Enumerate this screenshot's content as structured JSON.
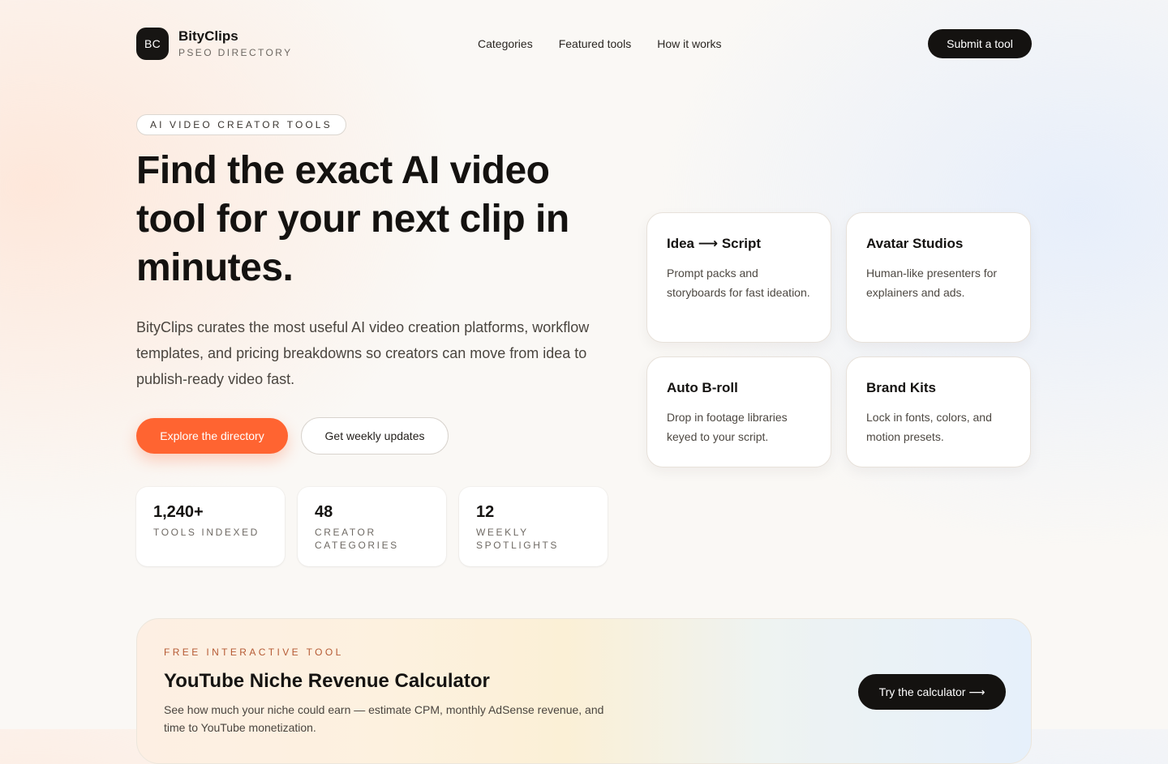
{
  "brand": {
    "mark": "BC",
    "name": "BityClips",
    "tagline": "PSEO DIRECTORY"
  },
  "nav": {
    "items": [
      {
        "label": "Categories"
      },
      {
        "label": "Featured tools"
      },
      {
        "label": "How it works"
      }
    ],
    "cta_label": "Submit a tool"
  },
  "hero": {
    "eyebrow": "AI VIDEO CREATOR TOOLS",
    "headline": "Find the exact AI video tool for your next clip in minutes.",
    "description": "BityClips curates the most useful AI video creation platforms, workflow templates, and pricing breakdowns so creators can move from idea to publish-ready video fast.",
    "primary_cta": "Explore the directory",
    "secondary_cta": "Get weekly updates"
  },
  "stats": [
    {
      "value": "1,240+",
      "label": "TOOLS INDEXED"
    },
    {
      "value": "48",
      "label": "CREATOR CATEGORIES"
    },
    {
      "value": "12",
      "label": "WEEKLY SPOTLIGHTS"
    }
  ],
  "features": [
    {
      "title": "Idea ⟶ Script",
      "description": "Prompt packs and storyboards for fast ideation."
    },
    {
      "title": "Avatar Studios",
      "description": "Human-like presenters for explainers and ads."
    },
    {
      "title": "Auto B-roll",
      "description": "Drop in footage libraries keyed to your script."
    },
    {
      "title": "Brand Kits",
      "description": "Lock in fonts, colors, and motion presets."
    }
  ],
  "calculator": {
    "kicker": "FREE INTERACTIVE TOOL",
    "title": "YouTube Niche Revenue Calculator",
    "description": "See how much your niche could earn — estimate CPM, monthly AdSense revenue, and time to YouTube monetization.",
    "cta": "Try the calculator ⟶"
  },
  "colors": {
    "accent": "#ff6431",
    "dark": "#141210",
    "background": "#faf8f5"
  }
}
